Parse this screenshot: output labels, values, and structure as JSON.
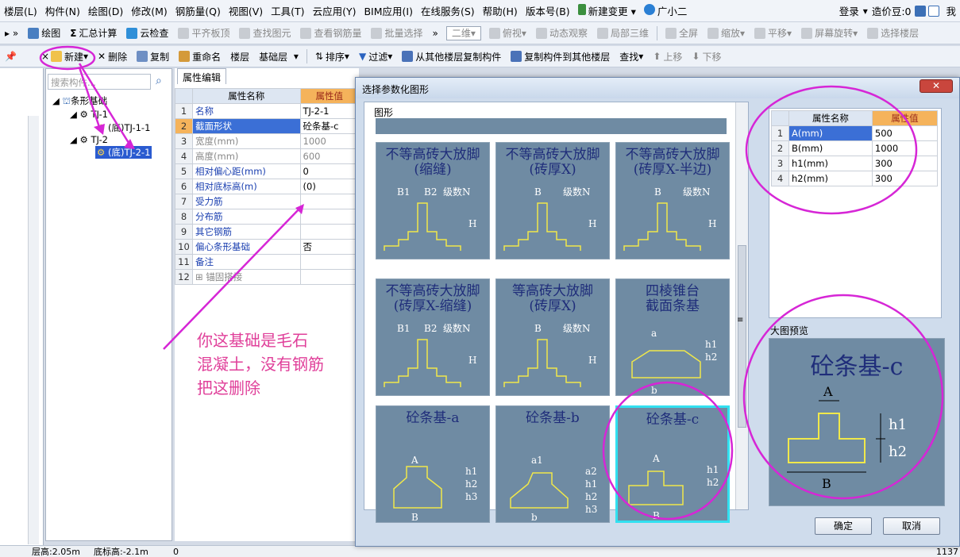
{
  "menu": [
    "楼层(L)",
    "构件(N)",
    "绘图(D)",
    "修改(M)",
    "钢筋量(Q)",
    "视图(V)",
    "工具(T)",
    "云应用(Y)",
    "BIM应用(I)",
    "在线服务(S)",
    "帮助(H)",
    "版本号(B)",
    "新建变更",
    "广小二"
  ],
  "menu_right": [
    "登录",
    "造价豆:0",
    "我"
  ],
  "toolbar1": [
    "绘图",
    "汇总计算",
    "云检查",
    "平齐板顶",
    "查找图元",
    "查看钢筋量",
    "批量选择",
    "二维",
    "俯视",
    "动态观察",
    "局部三维",
    "全屏",
    "缩放",
    "平移",
    "屏幕旋转",
    "选择楼层"
  ],
  "toolbar2": [
    "新建",
    "删除",
    "复制",
    "重命名",
    "楼层",
    "基础层",
    "排序",
    "过滤",
    "从其他楼层复制构件",
    "复制构件到其他楼层",
    "查找",
    "上移",
    "下移"
  ],
  "search_placeholder": "搜索构件...",
  "tree": {
    "root": "条形基础",
    "n1": "TJ-1",
    "n1c": "(底)TJ-1-1",
    "n2": "TJ-2",
    "n2c": "(底)TJ-2-1"
  },
  "prop": {
    "tab": "属性编辑",
    "col_name": "属性名称",
    "col_val": "属性值",
    "rows": [
      {
        "n": "1",
        "name": "名称",
        "val": "TJ-2-1"
      },
      {
        "n": "2",
        "name": "截面形状",
        "val": "砼条基-c"
      },
      {
        "n": "3",
        "name": "宽度(mm)",
        "val": "1000"
      },
      {
        "n": "4",
        "name": "高度(mm)",
        "val": "600"
      },
      {
        "n": "5",
        "name": "相对偏心距(mm)",
        "val": "0"
      },
      {
        "n": "6",
        "name": "相对底标高(m)",
        "val": "(0)"
      },
      {
        "n": "7",
        "name": "受力筋",
        "val": ""
      },
      {
        "n": "8",
        "name": "分布筋",
        "val": ""
      },
      {
        "n": "9",
        "name": "其它钢筋",
        "val": ""
      },
      {
        "n": "10",
        "name": "偏心条形基础",
        "val": "否"
      },
      {
        "n": "11",
        "name": "备注",
        "val": ""
      },
      {
        "n": "12",
        "name": "锚固搭接",
        "val": ""
      }
    ]
  },
  "annotation": [
    "你这基础是毛石",
    "混凝土，没有钢筋",
    "把这删除"
  ],
  "dialog": {
    "title": "选择参数化图形",
    "section": "图形",
    "cards": [
      {
        "t1": "不等高砖大放脚",
        "t2": "(缩缝)",
        "labels": [
          "B1",
          "B2",
          "级数N",
          "H"
        ]
      },
      {
        "t1": "不等高砖大放脚",
        "t2": "(砖厚X)",
        "labels": [
          "B",
          "级数N",
          "H"
        ]
      },
      {
        "t1": "不等高砖大放脚",
        "t2": "(砖厚X-半边)",
        "labels": [
          "B",
          "级数N",
          "H"
        ]
      },
      {
        "t1": "不等高砖大放脚",
        "t2": "(砖厚X-缩缝)",
        "labels": [
          "B1",
          "B2",
          "级数N",
          "H"
        ]
      },
      {
        "t1": "等高砖大放脚",
        "t2": "(砖厚X)",
        "labels": [
          "B",
          "级数N",
          "H"
        ]
      },
      {
        "t1": "四棱锥台",
        "t2": "截面条基",
        "labels": [
          "a",
          "h1",
          "h2",
          "b"
        ]
      },
      {
        "t1": "砼条基-a",
        "t2": "",
        "labels": [
          "A",
          "h1",
          "h2",
          "h3",
          "B"
        ]
      },
      {
        "t1": "砼条基-b",
        "t2": "",
        "labels": [
          "a1",
          "a2",
          "h1",
          "h2",
          "h3",
          "b"
        ]
      },
      {
        "t1": "砼条基-c",
        "t2": "",
        "labels": [
          "A",
          "h1",
          "h2",
          "B"
        ]
      }
    ],
    "attr_header": [
      "属性名称",
      "属性值"
    ],
    "attrs": [
      {
        "n": "1",
        "name": "A(mm)",
        "val": "500"
      },
      {
        "n": "2",
        "name": "B(mm)",
        "val": "1000"
      },
      {
        "n": "3",
        "name": "h1(mm)",
        "val": "300"
      },
      {
        "n": "4",
        "name": "h2(mm)",
        "val": "300"
      }
    ],
    "preview_label": "大图预览",
    "preview_title": "砼条基-c",
    "preview_labels": [
      "A",
      "h1",
      "h2",
      "B"
    ],
    "ok": "确定",
    "cancel": "取消"
  },
  "status": [
    "层高:2.05m",
    "底标高:-2.1m",
    "0",
    "1137"
  ],
  "colors": {
    "annotation": "#d626d6",
    "card_bg": "#6f8ba3",
    "selected_border": "#32e0f0",
    "highlight_col": "#f5b35b"
  }
}
